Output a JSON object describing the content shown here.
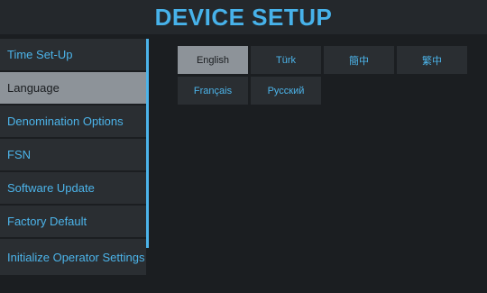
{
  "header": {
    "title": "DEVICE SETUP"
  },
  "sidebar": {
    "items": [
      {
        "label": "Time Set-Up"
      },
      {
        "label": "Language"
      },
      {
        "label": "Denomination Options"
      },
      {
        "label": "FSN"
      },
      {
        "label": "Software Update"
      },
      {
        "label": "Factory Default"
      },
      {
        "label": "Initialize Operator Settings"
      }
    ],
    "selected": "Language"
  },
  "languages": {
    "options": [
      {
        "label": "English"
      },
      {
        "label": "Türk"
      },
      {
        "label": "簡中"
      },
      {
        "label": "繁中"
      },
      {
        "label": "Français"
      },
      {
        "label": "Русский"
      }
    ],
    "selected": "English"
  },
  "colors": {
    "accent": "#47b2ea",
    "selected_bg": "#8d9399",
    "item_bg": "#2a2e32"
  }
}
